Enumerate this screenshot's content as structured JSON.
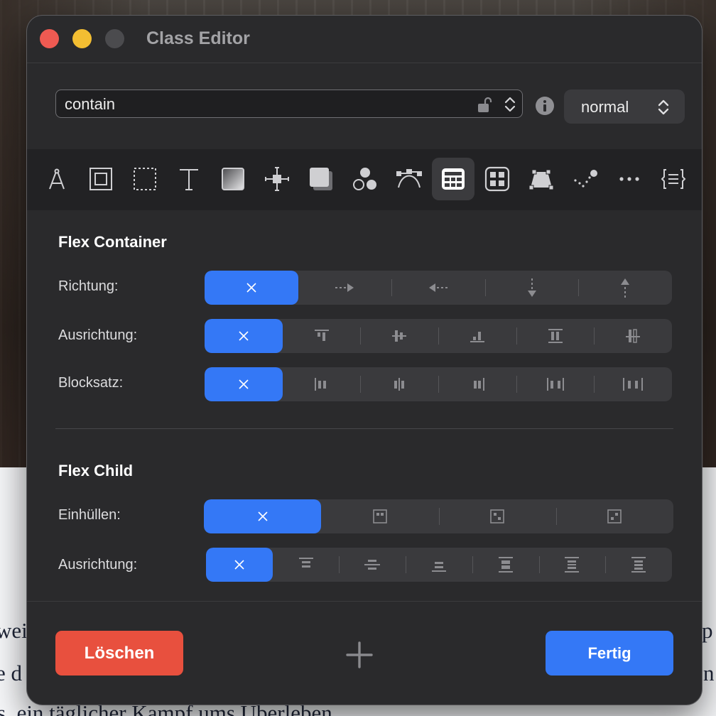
{
  "window": {
    "title": "Class Editor"
  },
  "class_field": {
    "value": "contain"
  },
  "state_select": {
    "value": "normal"
  },
  "toolbar": {
    "active_index": 9,
    "tools": [
      {
        "icon": "compass-icon"
      },
      {
        "icon": "box-model-icon"
      },
      {
        "icon": "dashed-border-icon"
      },
      {
        "icon": "text-icon"
      },
      {
        "icon": "gradient-icon"
      },
      {
        "icon": "position-icon"
      },
      {
        "icon": "shadow-icon"
      },
      {
        "icon": "circles-icon"
      },
      {
        "icon": "bezier-icon"
      },
      {
        "icon": "flex-layout-icon"
      },
      {
        "icon": "grid-icon"
      },
      {
        "icon": "transform-icon"
      },
      {
        "icon": "scatter-icon"
      },
      {
        "icon": "more-icon"
      },
      {
        "icon": "code-icon"
      }
    ]
  },
  "flex_container": {
    "title": "Flex Container",
    "richtung": {
      "label": "Richtung:",
      "selected": 0,
      "options": [
        "none",
        "row",
        "row-reverse",
        "column",
        "column-reverse"
      ]
    },
    "ausrichtung": {
      "label": "Ausrichtung:",
      "selected": 0,
      "options": [
        "none",
        "flex-start",
        "center",
        "flex-end",
        "stretch",
        "baseline"
      ]
    },
    "blocksatz": {
      "label": "Blocksatz:",
      "selected": 0,
      "options": [
        "none",
        "flex-start",
        "center",
        "flex-end",
        "space-between",
        "space-around"
      ]
    }
  },
  "flex_child": {
    "title": "Flex Child",
    "einhuellen": {
      "label": "Einhüllen:",
      "selected": 0,
      "options": [
        "none",
        "nowrap",
        "wrap",
        "wrap-reverse"
      ]
    },
    "ausrichtung": {
      "label": "Ausrichtung:",
      "selected": 0,
      "options": [
        "none",
        "flex-start",
        "center",
        "flex-end",
        "stretch",
        "baseline",
        "auto"
      ]
    }
  },
  "footer": {
    "delete_label": "Löschen",
    "done_label": "Fertig",
    "add_icon": "plus-icon"
  },
  "background_page": {
    "lines": [
      "wei",
      "p",
      "e d",
      "n",
      "s, ein täglicher Kampf ums Überleben."
    ]
  }
}
